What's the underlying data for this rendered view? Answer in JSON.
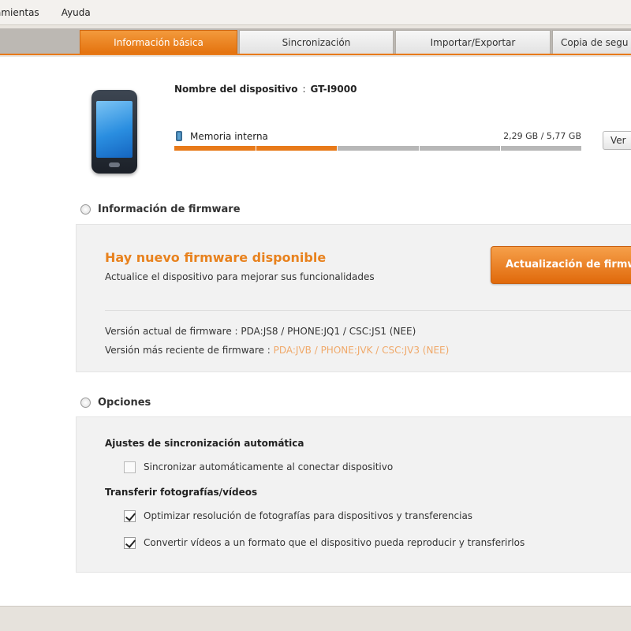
{
  "menubar": {
    "items": [
      "amientas",
      "Ayuda"
    ]
  },
  "tabs": [
    {
      "label": "Información básica",
      "active": true
    },
    {
      "label": "Sincronización",
      "active": false
    },
    {
      "label": "Importar/Exportar",
      "active": false
    },
    {
      "label": "Copia de segu",
      "active": false
    }
  ],
  "device": {
    "name_label": "Nombre del dispositivo",
    "name_separator": ":",
    "name_value": "GT-I9000",
    "memory_label": "Memoria interna",
    "memory_value": "2,29 GB / 5,77 GB",
    "memory_used_fraction": 0.4,
    "view_button": "Ver"
  },
  "firmware": {
    "section_title": "Información de firmware",
    "headline": "Hay nuevo firmware disponible",
    "subtext": "Actualice el dispositivo para mejorar sus funcionalidades",
    "update_button": "Actualización de firmware",
    "current_label": "Versión actual de firmware : ",
    "current_value": "PDA:JS8 / PHONE:JQ1 / CSC:JS1 (NEE)",
    "latest_label": "Versión más reciente de firmware : ",
    "latest_value": "PDA:JVB / PHONE:JVK / CSC:JV3 (NEE)"
  },
  "options": {
    "section_title": "Opciones",
    "groups": [
      {
        "title": "Ajustes de sincronización automática",
        "items": [
          {
            "label": "Sincronizar automáticamente al conectar dispositivo",
            "checked": false
          }
        ]
      },
      {
        "title": "Transferir fotografías/vídeos",
        "items": [
          {
            "label": "Optimizar resolución de fotografías para dispositivos y transferencias",
            "checked": true
          },
          {
            "label": "Convertir vídeos a un formato que el dispositivo pueda reproducir y transferirlos",
            "checked": true
          }
        ]
      }
    ]
  },
  "colors": {
    "accent": "#e87a1a",
    "highlight_text": "#f0a96a"
  }
}
